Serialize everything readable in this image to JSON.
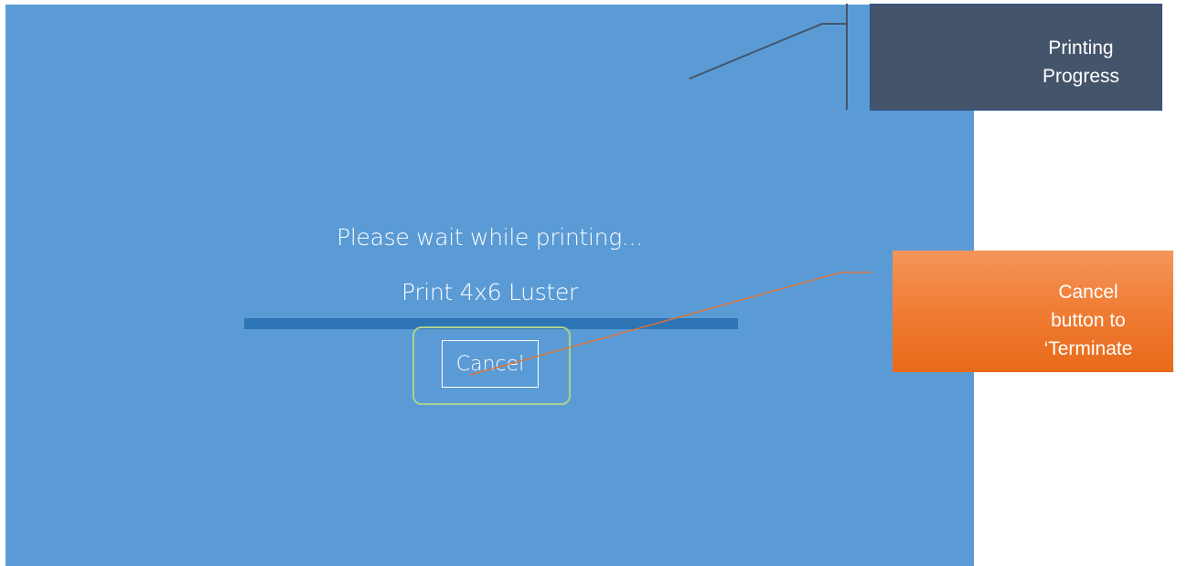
{
  "status": {
    "message": "Please wait while printing...",
    "job_name": "Print 4x6 Luster"
  },
  "cancel_button": {
    "label": "Cancel"
  },
  "annotations": {
    "progress_callout": {
      "line1": "Printing",
      "line2": "Progress"
    },
    "cancel_callout": {
      "line1": "Cancel",
      "line2": "button to",
      "line3": "‘Terminate"
    }
  },
  "colors": {
    "screen_background": "#5b9bd5",
    "progress_bar": "#2e75b6",
    "highlight_ring": "#a9d18e",
    "progress_callout_fill": "#44546a",
    "cancel_callout_fill": "#ef7a30"
  }
}
